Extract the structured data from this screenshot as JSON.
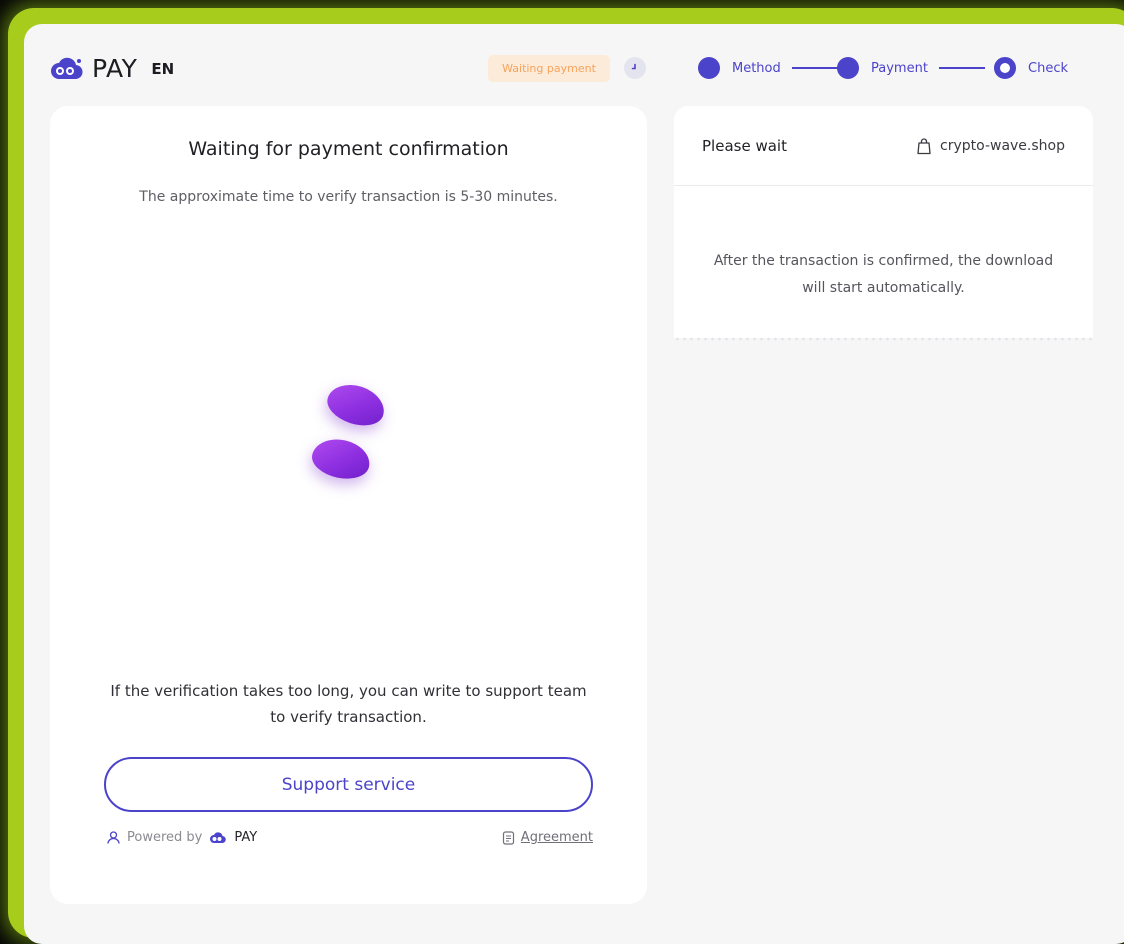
{
  "header": {
    "brand": "PAY",
    "language": "EN",
    "status_badge": "Waiting payment"
  },
  "steps": [
    {
      "label": "Method",
      "state": "done"
    },
    {
      "label": "Payment",
      "state": "done"
    },
    {
      "label": "Check",
      "state": "current"
    }
  ],
  "main": {
    "title": "Waiting for payment confirmation",
    "subtitle": "The approximate time to verify transaction is 5-30 minutes.",
    "help_line1": "If the verification takes too long, you can write to support team",
    "help_line2": "to verify transaction.",
    "support_button": "Support service",
    "powered_by": "Powered by",
    "powered_brand": "PAY",
    "agreement": "Agreement"
  },
  "side": {
    "title": "Please wait",
    "shop": "crypto-wave.shop",
    "message_line1": "After the transaction is confirmed, the download",
    "message_line2": "will start automatically."
  },
  "colors": {
    "accent": "#4b43c9",
    "badge_bg": "#fdebd9",
    "badge_text": "#f7a35b",
    "frame": "#a7cc1c",
    "loader": "#9a35e6"
  },
  "icons": [
    "cloud-logo-icon",
    "clock-icon",
    "bag-icon",
    "user-shield-icon",
    "document-icon"
  ]
}
